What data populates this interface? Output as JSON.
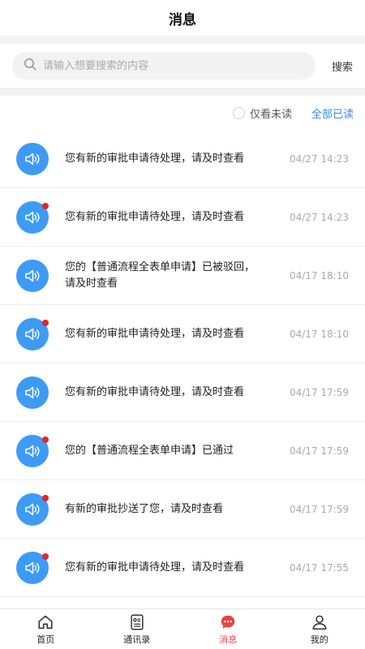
{
  "header": {
    "title": "消息"
  },
  "search": {
    "placeholder": "请输入想要搜索的内容",
    "button_label": "搜索"
  },
  "filter": {
    "unread_only_label": "仅看未读",
    "unread_only_checked": false,
    "mark_all_read_label": "全部已读"
  },
  "messages": [
    {
      "text": "您有新的审批申请待处理，请及时查看",
      "time": "04/27 14:23",
      "unread": false
    },
    {
      "text": "您有新的审批申请待处理，请及时查看",
      "time": "04/27 14:23",
      "unread": true
    },
    {
      "text": "您的【普通流程全表单申请】已被驳回，请及时查看",
      "time": "04/17 18:10",
      "unread": false
    },
    {
      "text": "您有新的审批申请待处理，请及时查看",
      "time": "04/17 18:10",
      "unread": true
    },
    {
      "text": "您有新的审批申请待处理，请及时查看",
      "time": "04/17 17:59",
      "unread": false
    },
    {
      "text": "您的【普通流程全表单申请】已通过",
      "time": "04/17 17:59",
      "unread": true
    },
    {
      "text": "有新的审批抄送了您，请及时查看",
      "time": "04/17 17:59",
      "unread": true
    },
    {
      "text": "您有新的审批申请待处理，请及时查看",
      "time": "04/17 17:55",
      "unread": true
    }
  ],
  "tabbar": {
    "items": [
      {
        "label": "首页",
        "icon": "home-icon",
        "active": false
      },
      {
        "label": "通讯录",
        "icon": "contacts-icon",
        "active": false
      },
      {
        "label": "消息",
        "icon": "message-icon",
        "active": true
      },
      {
        "label": "我的",
        "icon": "user-icon",
        "active": false
      }
    ]
  },
  "colors": {
    "accent": "#2f8af5",
    "avatar_bg": "#3d9bf6",
    "unread_dot": "#e0262f",
    "active_tab": "#e84444"
  }
}
